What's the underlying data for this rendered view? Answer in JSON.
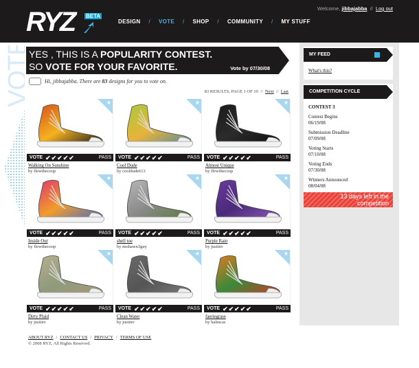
{
  "header": {
    "logo_text": "RYZ",
    "logo_badge": "BETA",
    "welcome_prefix": "Welcome,",
    "username": "jibbajabba",
    "separator": "//",
    "logout": "Log out",
    "nav": [
      {
        "label": "DESIGN",
        "active": false
      },
      {
        "label": "VOTE",
        "active": true
      },
      {
        "label": "SHOP",
        "active": false
      },
      {
        "label": "COMMUNITY",
        "active": false
      },
      {
        "label": "MY STUFF",
        "active": false
      }
    ],
    "nav_separator": "/"
  },
  "side_title": "VOTE",
  "banner": {
    "line1_prefix": "YES , THIS IS A ",
    "line1_bold": "POPULARITY CONTEST.",
    "line2_prefix": "SO ",
    "line2_bold": "VOTE FOR YOUR FAVORITE.",
    "vote_by": "Vote by 07/30/08"
  },
  "greeting": {
    "prefix": "Hi, jibbajabba. There are ",
    "count": "83",
    "suffix": " designs for you to vote on."
  },
  "results": {
    "text": "83 RESULTS, PAGE 1 OF 10",
    "sep": "//",
    "next": "Next",
    "last": "Last"
  },
  "vote_bar": {
    "vote": "VOTE",
    "pass": "PASS",
    "check": "✔"
  },
  "designs": [
    {
      "title": "Walking On Sunshine",
      "by": "by flewthecoop",
      "colors": [
        "#d8541f",
        "#f4b21e",
        "#1d1d1d"
      ]
    },
    {
      "title": "Cool Dude",
      "by": "by cooldude613",
      "colors": [
        "#a9c93b",
        "#e7b43a",
        "#5d8c9a"
      ]
    },
    {
      "title": "Almost Unique",
      "by": "by flewthecoop",
      "colors": [
        "#1a1a1a",
        "#2b2b2b",
        "#111111"
      ]
    },
    {
      "title": "Inside Out",
      "by": "by flewthecoop",
      "colors": [
        "#e03a6c",
        "#f29c2b",
        "#4b6cc6"
      ]
    },
    {
      "title": "shell toe",
      "by": "by neshawn3guy",
      "colors": [
        "#b6b6b6",
        "#8a8a8a",
        "#5a7a3a"
      ]
    },
    {
      "title": "Purple Rain",
      "by": "by justinv",
      "colors": [
        "#6a3a9c",
        "#4b2a7a",
        "#8a5ab8"
      ]
    },
    {
      "title": "Dirty Plaid",
      "by": "by justinv",
      "colors": [
        "#b7b08f",
        "#8f9a7c",
        "#a89a7a"
      ]
    },
    {
      "title": "Clean Water",
      "by": "by justinv",
      "colors": [
        "#6b6b6b",
        "#555555",
        "#7a7a7a"
      ]
    },
    {
      "title": "faeriegrase",
      "by": "by halmcas",
      "colors": [
        "#e07a1f",
        "#3a8a3a",
        "#c83a2a"
      ]
    }
  ],
  "sidebar": {
    "feed_title": "MY FEED",
    "whats_this": "What's this?",
    "cycle_title": "COMPETITION CYCLE",
    "contest": "CONTEST 3",
    "cycle": [
      {
        "label": "Contest Begins",
        "date": "06/19/08"
      },
      {
        "label": "Submission Deadline",
        "date": "07/09/08"
      },
      {
        "label": "Voting Starts",
        "date": "07/10/08"
      },
      {
        "label": "Voting Ends",
        "date": "07/30/08"
      },
      {
        "label": "Winners Announced",
        "date": "08/04/08"
      }
    ],
    "days_line1": "13 days left in the",
    "days_line2": "competition"
  },
  "footer": {
    "links": [
      "ABOUT RYZ",
      "CONTACT US",
      "PRIVACY",
      "TERMS OF USE"
    ],
    "sep": "/",
    "copyright": "© 2008 RYZ, All Rights Reserved."
  }
}
